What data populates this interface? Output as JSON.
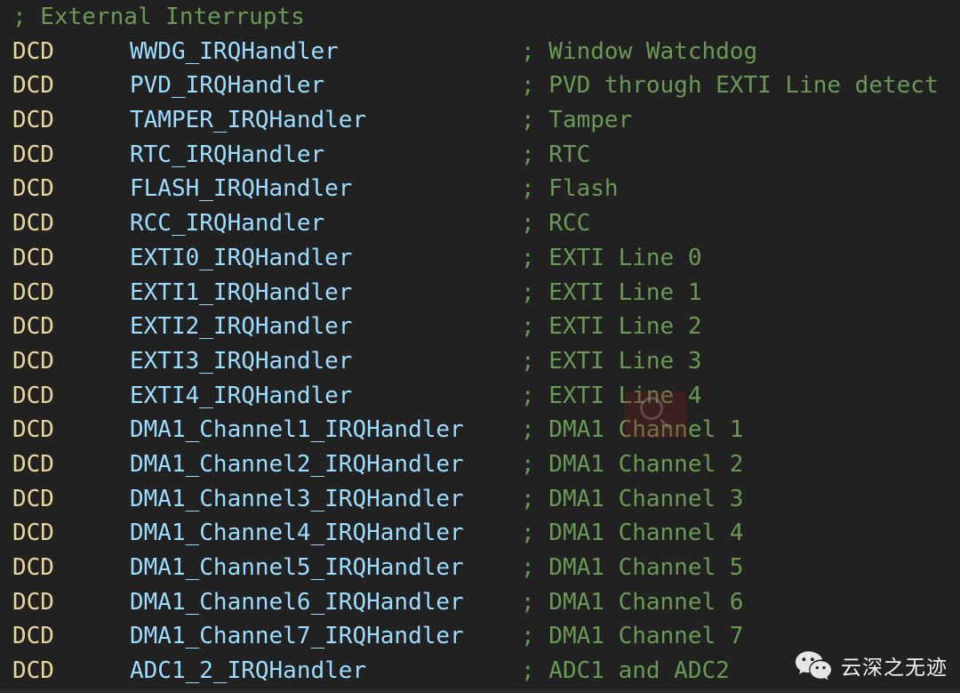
{
  "editor": {
    "language": "ARM Assembly",
    "background_color": "#212121",
    "colors": {
      "keyword": "#e8d69a",
      "identifier": "#9cdcfe",
      "comment": "#6a9955",
      "background": "#212121"
    }
  },
  "code": {
    "lines": [
      {
        "kind": "comment-only",
        "comment": "; External Interrupts"
      },
      {
        "kind": "directive",
        "keyword": "DCD",
        "symbol": "WWDG_IRQHandler",
        "comment": "; Window Watchdog"
      },
      {
        "kind": "directive",
        "keyword": "DCD",
        "symbol": "PVD_IRQHandler",
        "comment": "; PVD through EXTI Line detect"
      },
      {
        "kind": "directive",
        "keyword": "DCD",
        "symbol": "TAMPER_IRQHandler",
        "comment": "; Tamper"
      },
      {
        "kind": "directive",
        "keyword": "DCD",
        "symbol": "RTC_IRQHandler",
        "comment": "; RTC"
      },
      {
        "kind": "directive",
        "keyword": "DCD",
        "symbol": "FLASH_IRQHandler",
        "comment": "; Flash"
      },
      {
        "kind": "directive",
        "keyword": "DCD",
        "symbol": "RCC_IRQHandler",
        "comment": "; RCC"
      },
      {
        "kind": "directive",
        "keyword": "DCD",
        "symbol": "EXTI0_IRQHandler",
        "comment": "; EXTI Line 0"
      },
      {
        "kind": "directive",
        "keyword": "DCD",
        "symbol": "EXTI1_IRQHandler",
        "comment": "; EXTI Line 1"
      },
      {
        "kind": "directive",
        "keyword": "DCD",
        "symbol": "EXTI2_IRQHandler",
        "comment": "; EXTI Line 2"
      },
      {
        "kind": "directive",
        "keyword": "DCD",
        "symbol": "EXTI3_IRQHandler",
        "comment": "; EXTI Line 3"
      },
      {
        "kind": "directive",
        "keyword": "DCD",
        "symbol": "EXTI4_IRQHandler",
        "comment": "; EXTI Line 4"
      },
      {
        "kind": "directive",
        "keyword": "DCD",
        "symbol": "DMA1_Channel1_IRQHandler",
        "comment": "; DMA1 Channel 1"
      },
      {
        "kind": "directive",
        "keyword": "DCD",
        "symbol": "DMA1_Channel2_IRQHandler",
        "comment": "; DMA1 Channel 2"
      },
      {
        "kind": "directive",
        "keyword": "DCD",
        "symbol": "DMA1_Channel3_IRQHandler",
        "comment": "; DMA1 Channel 3"
      },
      {
        "kind": "directive",
        "keyword": "DCD",
        "symbol": "DMA1_Channel4_IRQHandler",
        "comment": "; DMA1 Channel 4"
      },
      {
        "kind": "directive",
        "keyword": "DCD",
        "symbol": "DMA1_Channel5_IRQHandler",
        "comment": "; DMA1 Channel 5"
      },
      {
        "kind": "directive",
        "keyword": "DCD",
        "symbol": "DMA1_Channel6_IRQHandler",
        "comment": "; DMA1 Channel 6"
      },
      {
        "kind": "directive",
        "keyword": "DCD",
        "symbol": "DMA1_Channel7_IRQHandler",
        "comment": "; DMA1 Channel 7"
      },
      {
        "kind": "directive",
        "keyword": "DCD",
        "symbol": "ADC1_2_IRQHandler",
        "comment": "; ADC1 and ADC2"
      }
    ]
  },
  "watermarks": {
    "stamp": {
      "icon": "magnifier-icon",
      "tint_color": "#781818"
    },
    "wechat": {
      "icon": "wechat-logo-icon",
      "account_name": "云深之无迹"
    }
  }
}
